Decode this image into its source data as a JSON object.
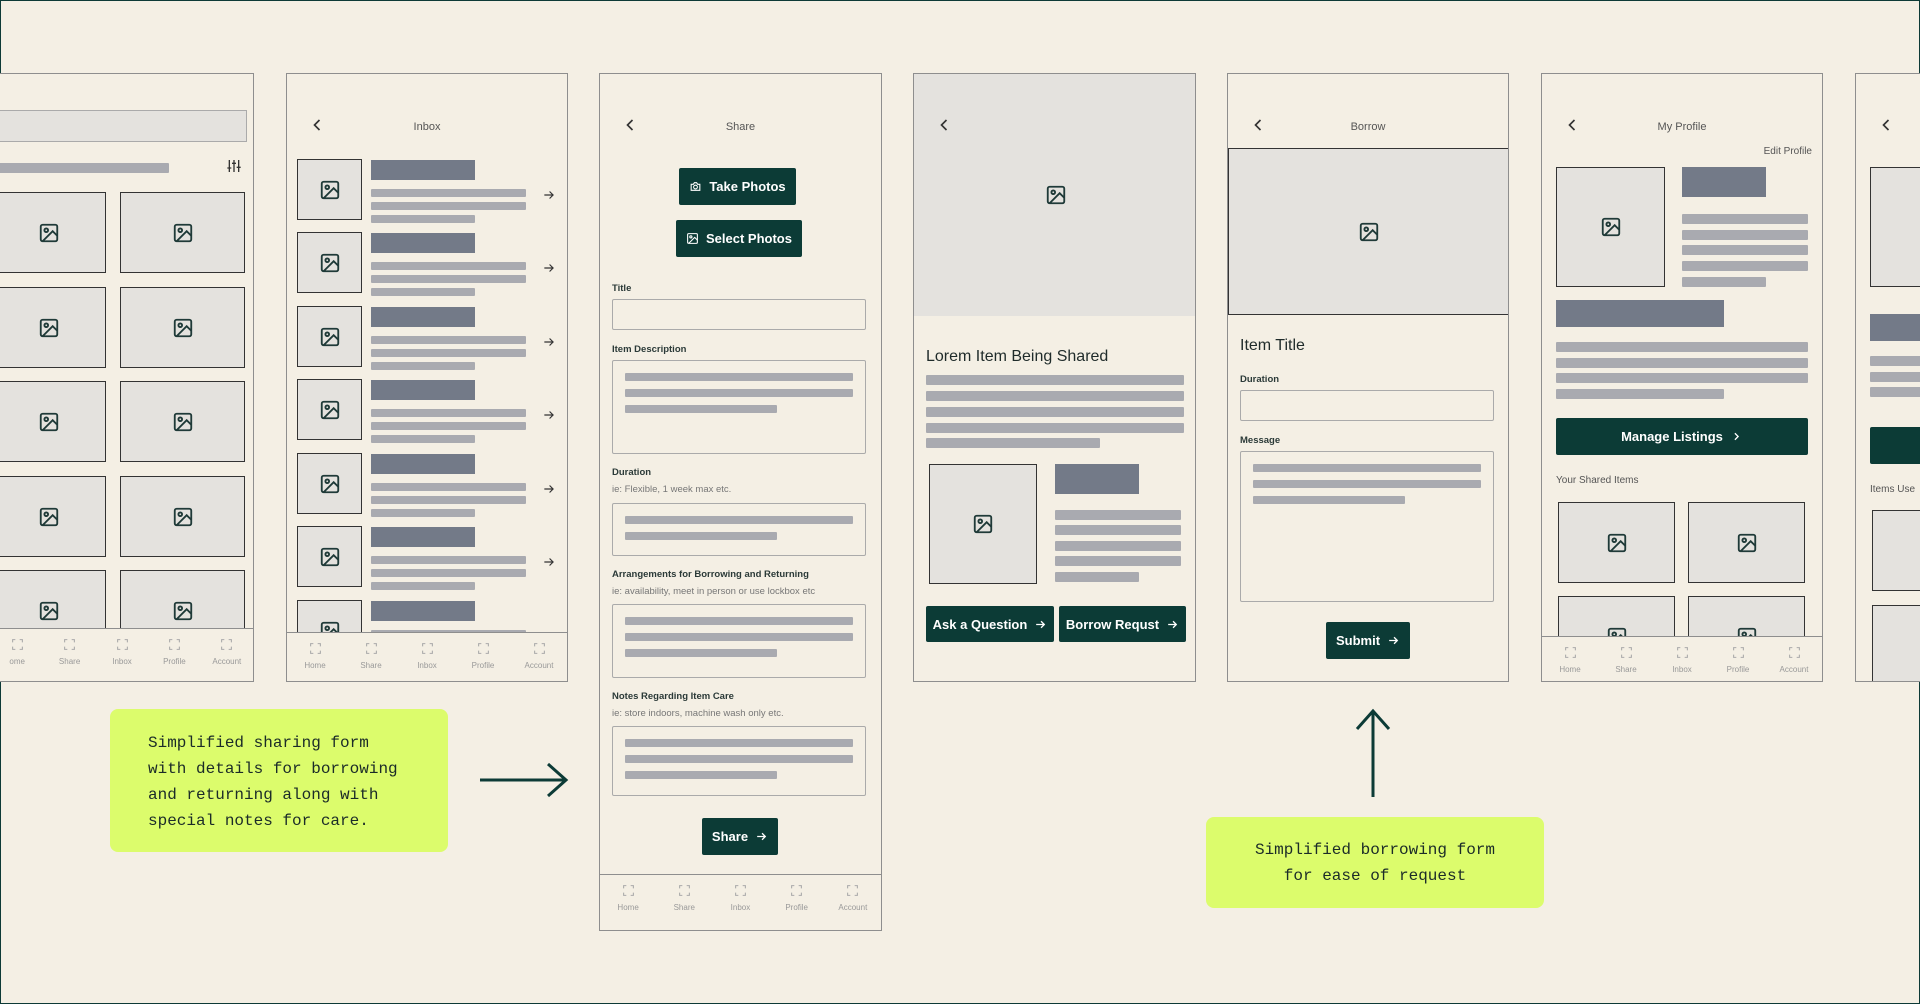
{
  "tabbar": [
    "Home",
    "Share",
    "Inbox",
    "Profile",
    "Account"
  ],
  "tabbar_cut": [
    "ome",
    "Share",
    "Inbox",
    "Profile",
    "Account"
  ],
  "inbox": {
    "title": "Inbox"
  },
  "share": {
    "title": "Share",
    "take_photos": "Take Photos",
    "select_photos": "Select Photos",
    "title_label": "Title",
    "desc_label": "Item Description",
    "duration_label": "Duration",
    "duration_hint": "ie: Flexible, 1 week max etc.",
    "arrangements_label": "Arrangements for Borrowing and Returning",
    "arrangements_hint": "ie: availability, meet in person or use lockbox etc",
    "notes_label": "Notes Regarding Item Care",
    "notes_hint": "ie: store indoors, machine wash only etc.",
    "share_button": "Share"
  },
  "item": {
    "heading": "Lorem Item Being Shared",
    "ask_button": "Ask a Question",
    "borrow_button": "Borrow Requst"
  },
  "borrow": {
    "title": "Borrow",
    "item_title": "Item Title",
    "duration_label": "Duration",
    "message_label": "Message",
    "submit_button": "Submit"
  },
  "profile": {
    "title": "My Profile",
    "edit": "Edit Profile",
    "manage_button": "Manage Listings",
    "shared_label": "Your Shared Items"
  },
  "partial": {
    "label": "Items Use"
  },
  "notes": {
    "left": [
      "Simplified sharing form",
      "with details for borrowing",
      "and returning along with",
      "special notes for care."
    ],
    "right": [
      "Simplified borrowing form",
      "for ease of request"
    ]
  },
  "colors": {
    "accent": "#0c3b36",
    "highlight": "#dcfc6c",
    "background": "#f4efe4"
  }
}
